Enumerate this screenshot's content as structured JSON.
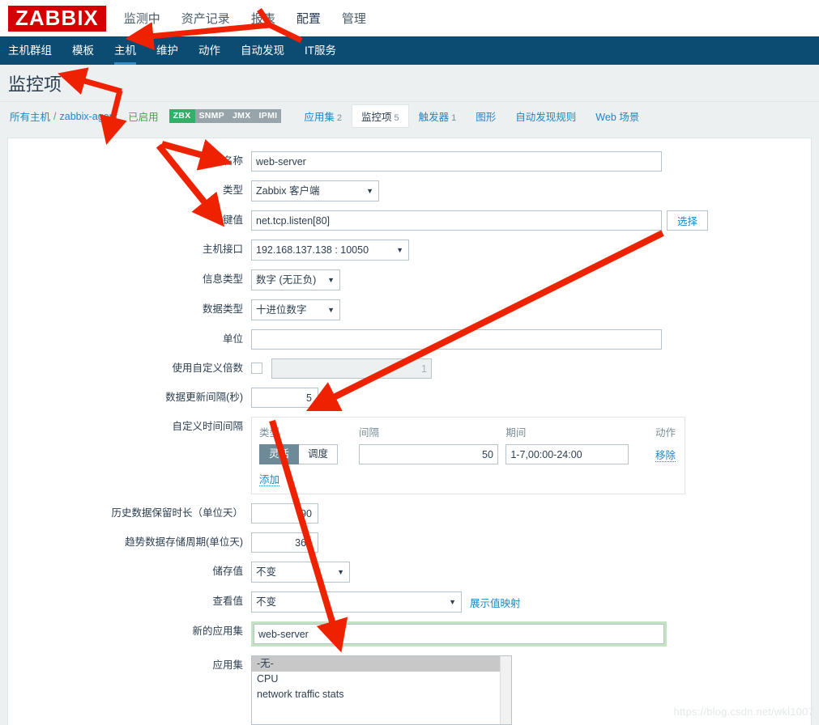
{
  "brand": {
    "logo": "ZABBIX",
    "logo_bg": "#d40000"
  },
  "topmenu": [
    {
      "label": "监测中",
      "active": false
    },
    {
      "label": "资产记录",
      "active": false
    },
    {
      "label": "报表",
      "active": false
    },
    {
      "label": "配置",
      "active": true
    },
    {
      "label": "管理",
      "active": false
    }
  ],
  "navmenu": [
    {
      "label": "主机群组",
      "active": false
    },
    {
      "label": "模板",
      "active": false
    },
    {
      "label": "主机",
      "active": true
    },
    {
      "label": "维护",
      "active": false
    },
    {
      "label": "动作",
      "active": false
    },
    {
      "label": "自动发现",
      "active": false
    },
    {
      "label": "IT服务",
      "active": false
    }
  ],
  "page": {
    "title": "监控项"
  },
  "breadcrumb": {
    "all_hosts": "所有主机",
    "separator": "/",
    "host": "zabbix-agent",
    "status": "已启用",
    "interfaces": [
      {
        "label": "ZBX",
        "on": true
      },
      {
        "label": "SNMP",
        "on": false
      },
      {
        "label": "JMX",
        "on": false
      },
      {
        "label": "IPMI",
        "on": false
      }
    ],
    "tabs": [
      {
        "label": "应用集",
        "count": "2",
        "active": false
      },
      {
        "label": "监控项",
        "count": "5",
        "active": true
      },
      {
        "label": "触发器",
        "count": "1",
        "active": false
      },
      {
        "label": "图形",
        "count": "",
        "active": false
      },
      {
        "label": "自动发现规则",
        "count": "",
        "active": false
      },
      {
        "label": "Web 场景",
        "count": "",
        "active": false
      }
    ]
  },
  "form": {
    "name": {
      "label": "名称",
      "value": "web-server"
    },
    "type": {
      "label": "类型",
      "value": "Zabbix 客户端"
    },
    "key": {
      "label": "键值",
      "value": "net.tcp.listen[80]",
      "select_button": "选择"
    },
    "host_interface": {
      "label": "主机接口",
      "value": "192.168.137.138 : 10050"
    },
    "info_type": {
      "label": "信息类型",
      "value": "数字 (无正负)"
    },
    "data_type": {
      "label": "数据类型",
      "value": "十进位数字"
    },
    "units": {
      "label": "单位",
      "value": ""
    },
    "custom_multiplier": {
      "label": "使用自定义倍数",
      "value": "1",
      "checked": false
    },
    "update_interval": {
      "label": "数据更新间隔(秒)",
      "value": "5"
    },
    "custom_intervals": {
      "label": "自定义时间间隔",
      "headers": {
        "type": "类型",
        "interval": "间隔",
        "period": "期间",
        "action": "动作"
      },
      "rows": [
        {
          "type_flexible": "灵活",
          "type_scheduling": "调度",
          "type_selected": "灵活",
          "interval": "50",
          "period": "1-7,00:00-24:00",
          "action": "移除"
        }
      ],
      "add_label": "添加"
    },
    "history": {
      "label": "历史数据保留时长（单位天）",
      "value": "90"
    },
    "trends": {
      "label": "趋势数据存储周期(单位天)",
      "value": "365"
    },
    "store_value": {
      "label": "储存值",
      "value": "不变"
    },
    "show_value": {
      "label": "查看值",
      "value": "不变",
      "link": "展示值映射"
    },
    "new_application": {
      "label": "新的应用集",
      "value": "web-server"
    },
    "applications": {
      "label": "应用集",
      "options": [
        {
          "label": "-无-",
          "selected": true
        },
        {
          "label": "CPU",
          "selected": false
        },
        {
          "label": "network traffic stats",
          "selected": false
        }
      ]
    }
  },
  "watermark": "https://blog.csdn.net/wkl1007",
  "colors": {
    "nav_bg": "#0c4b72",
    "accent_link": "#1e87c4",
    "interface_on": "#34af67",
    "annotation": "#ee2200"
  }
}
